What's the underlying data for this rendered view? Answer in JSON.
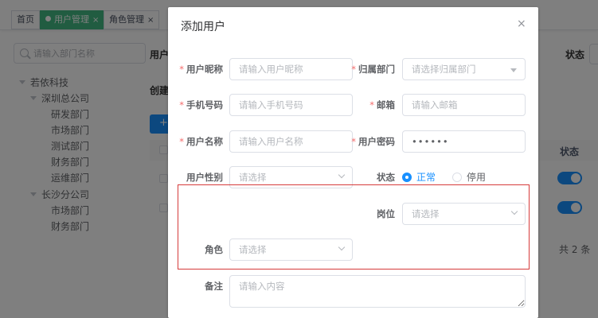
{
  "tabs": [
    {
      "label": "首页",
      "closable": false,
      "active": false
    },
    {
      "label": "用户管理",
      "closable": true,
      "active": true
    },
    {
      "label": "角色管理",
      "closable": true,
      "active": false
    }
  ],
  "tab_close_glyph": "×",
  "sidebar": {
    "search_placeholder": "请输入部门名称",
    "tree": [
      {
        "label": "若依科技",
        "level": 0,
        "expanded": true
      },
      {
        "label": "深圳总公司",
        "level": 1,
        "expanded": true
      },
      {
        "label": "研发部门",
        "level": 2
      },
      {
        "label": "市场部门",
        "level": 2
      },
      {
        "label": "测试部门",
        "level": 2
      },
      {
        "label": "财务部门",
        "level": 2
      },
      {
        "label": "运维部门",
        "level": 2
      },
      {
        "label": "长沙分公司",
        "level": 1,
        "expanded": true
      },
      {
        "label": "市场部门",
        "level": 2
      },
      {
        "label": "财务部门",
        "level": 2
      }
    ]
  },
  "background": {
    "user_label": "用户",
    "status_label": "状态",
    "created_label": "创建",
    "add_button": "+",
    "table_status_header": "状态",
    "pagination_total": "共 2 条"
  },
  "dialog": {
    "title": "添加用户",
    "close_glyph": "×",
    "fields": {
      "nickname": {
        "label": "用户昵称",
        "required": true,
        "placeholder": "请输入用户昵称"
      },
      "dept": {
        "label": "归属部门",
        "required": true,
        "placeholder": "请选择归属部门"
      },
      "phone": {
        "label": "手机号码",
        "required": true,
        "placeholder": "请输入手机号码"
      },
      "email": {
        "label": "邮箱",
        "required": true,
        "placeholder": "请输入邮箱"
      },
      "username": {
        "label": "用户名称",
        "required": true,
        "placeholder": "请输入用户名称"
      },
      "password": {
        "label": "用户密码",
        "required": true,
        "value": "••••••"
      },
      "gender": {
        "label": "用户性别",
        "placeholder": "请选择"
      },
      "status": {
        "label": "状态",
        "options": [
          "正常",
          "停用"
        ],
        "selected": "正常"
      },
      "post": {
        "label": "岗位",
        "placeholder": "请选择"
      },
      "role": {
        "label": "角色",
        "placeholder": "请选择"
      },
      "remark": {
        "label": "备注",
        "placeholder": "请输入内容"
      }
    },
    "required_mark": "*"
  },
  "colors": {
    "primary": "#1890ff",
    "required": "#f56c6c",
    "highlight_border": "#d63b3b",
    "tab_active": "#42b983"
  }
}
